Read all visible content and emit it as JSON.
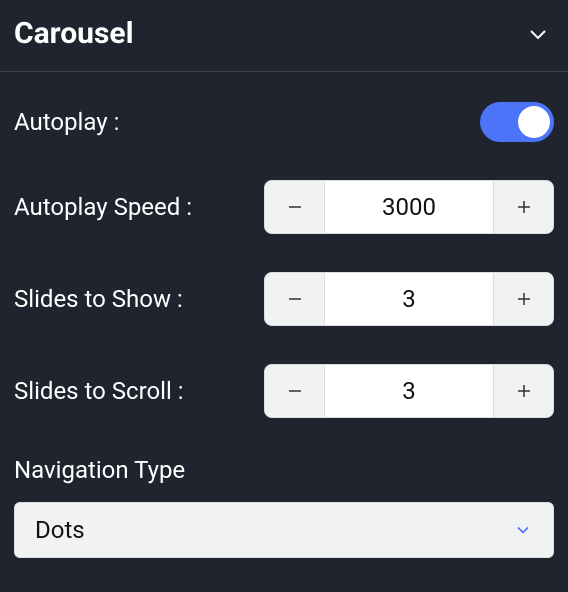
{
  "panel": {
    "title": "Carousel"
  },
  "settings": {
    "autoplay": {
      "label": "Autoplay :",
      "enabled": true
    },
    "autoplay_speed": {
      "label": "Autoplay Speed :",
      "value": "3000"
    },
    "slides_to_show": {
      "label": "Slides to Show :",
      "value": "3"
    },
    "slides_to_scroll": {
      "label": "Slides to Scroll :",
      "value": "3"
    },
    "navigation_type": {
      "label": "Navigation Type",
      "selected": "Dots"
    }
  }
}
